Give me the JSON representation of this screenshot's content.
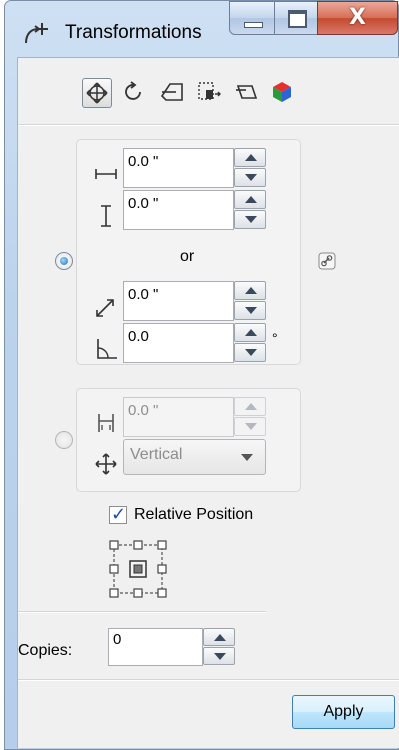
{
  "window": {
    "title": "Transformations",
    "close_glyph": "X"
  },
  "toolbar": {
    "tools": [
      "position-icon",
      "rotate-icon",
      "scale-mirror-icon",
      "size-icon",
      "skew-icon",
      "3d-cube-icon"
    ],
    "active_tool": "position-icon"
  },
  "position_group": {
    "width_value": "0.0 \"",
    "height_value": "0.0 \"",
    "or_label": "or",
    "distance_value": "0.0 \"",
    "angle_value": "0.0",
    "degree_symbol": "°"
  },
  "duplicate_group": {
    "distance_value": "0.0 \"",
    "direction_value": "Vertical"
  },
  "relative_position": {
    "label": "Relative Position",
    "checked": true
  },
  "copies": {
    "label": "Copies:",
    "value": "0"
  },
  "apply_label": "Apply",
  "colors": {
    "title_bar": "#bcd3ec",
    "close_button": "#c44b2f",
    "panel": "#f0f0f0",
    "apply_button": "#bee6fd"
  }
}
